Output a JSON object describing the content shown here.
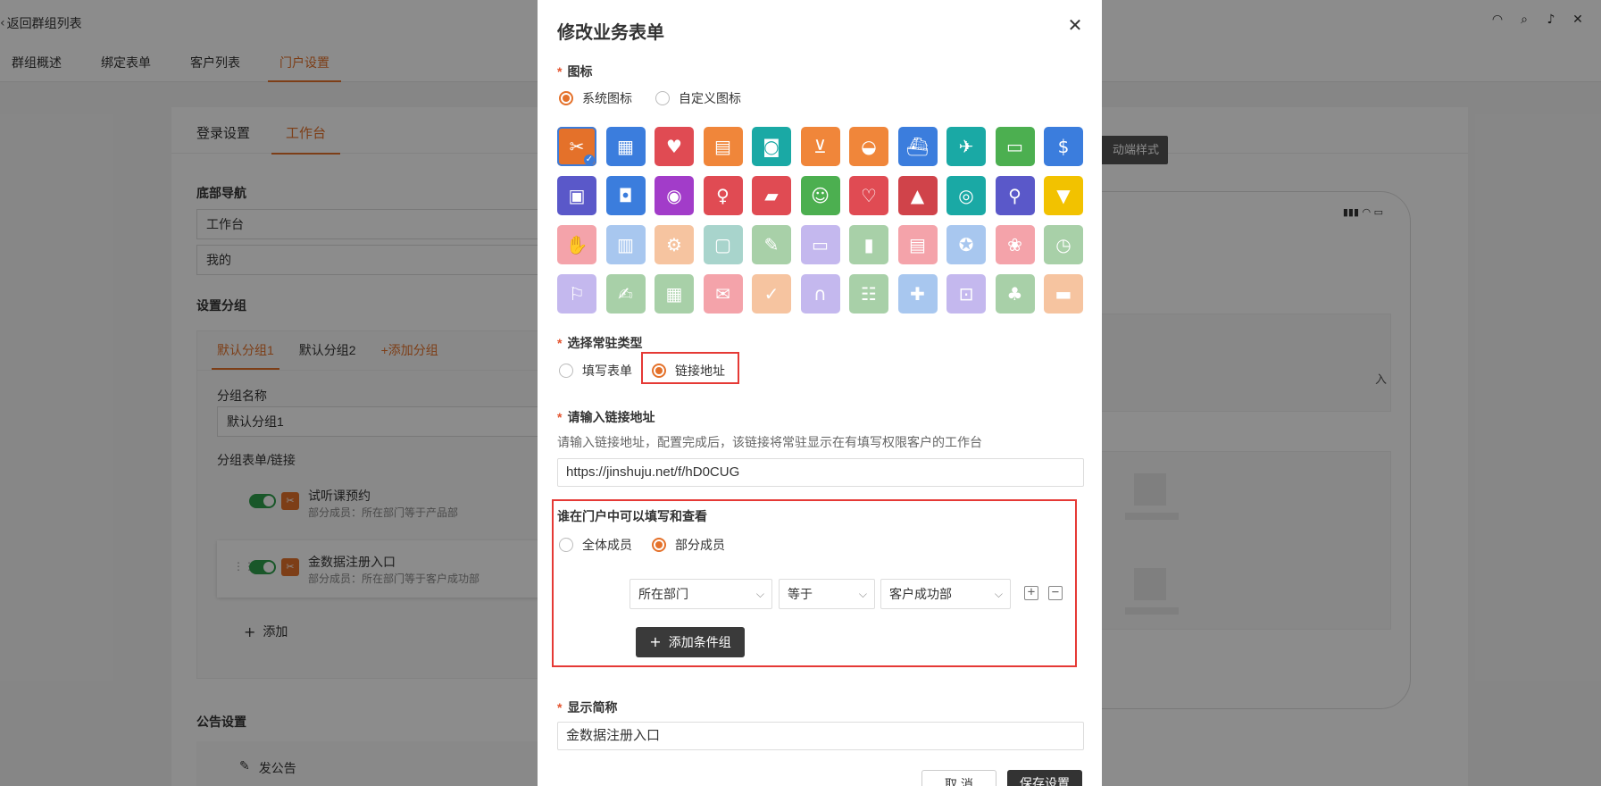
{
  "app": {
    "back_label": "返回群组列表",
    "top_tabs": [
      "群组概述",
      "绑定表单",
      "客户列表",
      "门户设置"
    ],
    "active_top_tab": 3,
    "sub_tabs": [
      "登录设置",
      "工作台"
    ],
    "bottom_nav_title": "底部导航",
    "bottom_nav_items": [
      "工作台",
      "我的"
    ],
    "group_settings_title": "设置分组",
    "group_tabs": [
      "默认分组1",
      "默认分组2",
      "+添加分组"
    ],
    "group_name_label": "分组名称",
    "group_name_value": "默认分组1",
    "group_links_label": "分组表单/链接",
    "links": [
      {
        "title": "试听课预约",
        "sub": "部分成员：所在部门等于产品部"
      },
      {
        "title": "金数据注册入口",
        "sub": "部分成员：所在部门等于客户成功部"
      }
    ],
    "add_label": "添加",
    "announcement_title": "公告设置",
    "post_announcement": "发公告",
    "dark_button": "动端样式",
    "phone_status": "▮▮▮ ◠ ▭",
    "phone_card_text": "入"
  },
  "modal": {
    "title": "修改业务表单",
    "icon_label": "图标",
    "icon_options": [
      "系统图标",
      "自定义图标"
    ],
    "icon_grid": [
      {
        "name": "fork-knife-icon",
        "glyph": "✂",
        "bg": "#e4712a"
      },
      {
        "name": "factory-icon",
        "glyph": "▦",
        "bg": "#3b7ddd"
      },
      {
        "name": "heart-icon",
        "glyph": "♥",
        "bg": "#e04b53"
      },
      {
        "name": "document-icon",
        "glyph": "▤",
        "bg": "#f0863a"
      },
      {
        "name": "drink-icon",
        "glyph": "◙",
        "bg": "#1aa9a5"
      },
      {
        "name": "cart-icon",
        "glyph": "⊻",
        "bg": "#f0863a"
      },
      {
        "name": "bowl-icon",
        "glyph": "◒",
        "bg": "#f0863a"
      },
      {
        "name": "ship-icon",
        "glyph": "⛴",
        "bg": "#3b7ddd"
      },
      {
        "name": "plane-icon",
        "glyph": "✈",
        "bg": "#1aa9a5"
      },
      {
        "name": "book-icon",
        "glyph": "▭",
        "bg": "#4caf50"
      },
      {
        "name": "dollar-icon",
        "glyph": "$",
        "bg": "#3b7ddd"
      },
      {
        "name": "bus-icon",
        "glyph": "▣",
        "bg": "#5a58c9"
      },
      {
        "name": "taxi-icon",
        "glyph": "◘",
        "bg": "#3b7ddd"
      },
      {
        "name": "camera-app-icon",
        "glyph": "◉",
        "bg": "#a23cc9"
      },
      {
        "name": "dress-icon",
        "glyph": "♀",
        "bg": "#e04b53"
      },
      {
        "name": "cake-icon",
        "glyph": "▰",
        "bg": "#e04b53"
      },
      {
        "name": "person-icon",
        "glyph": "☺",
        "bg": "#4caf50"
      },
      {
        "name": "heart-hand-icon",
        "glyph": "♡",
        "bg": "#e04b53"
      },
      {
        "name": "graduation-cap-icon",
        "glyph": "▲",
        "bg": "#d0434a"
      },
      {
        "name": "camera-icon",
        "glyph": "◎",
        "bg": "#1aa9a5"
      },
      {
        "name": "bicycle-icon",
        "glyph": "⚲",
        "bg": "#5a58c9"
      },
      {
        "name": "tshirt-icon",
        "glyph": "▼",
        "bg": "#f2c200"
      },
      {
        "name": "handshake-icon",
        "glyph": "✋",
        "bg": "#f4a3aa"
      },
      {
        "name": "chart-icon",
        "glyph": "▥",
        "bg": "#a8c7ef"
      },
      {
        "name": "tools-icon",
        "glyph": "⚙",
        "bg": "#f6c4a0"
      },
      {
        "name": "presentation-icon",
        "glyph": "▢",
        "bg": "#a8d4cc"
      },
      {
        "name": "stationery-icon",
        "glyph": "✎",
        "bg": "#a8d0a8"
      },
      {
        "name": "computer-icon",
        "glyph": "▭",
        "bg": "#c4b8ee"
      },
      {
        "name": "bottle-icon",
        "glyph": "▮",
        "bg": "#a8d0a8"
      },
      {
        "name": "gallery-icon",
        "glyph": "▤",
        "bg": "#f4a3aa"
      },
      {
        "name": "medal-icon",
        "glyph": "✪",
        "bg": "#a8c7ef"
      },
      {
        "name": "laurel-icon",
        "glyph": "❀",
        "bg": "#f4a3aa"
      },
      {
        "name": "cup-icon",
        "glyph": "◷",
        "bg": "#a8d0a8"
      },
      {
        "name": "location-icon",
        "glyph": "⚐",
        "bg": "#c4b8ee"
      },
      {
        "name": "register-icon",
        "glyph": "✍",
        "bg": "#a8d0a8"
      },
      {
        "name": "building-icon",
        "glyph": "▦",
        "bg": "#a8d0a8"
      },
      {
        "name": "gift-icon",
        "glyph": "✉",
        "bg": "#f4a3aa"
      },
      {
        "name": "message-icon",
        "glyph": "✓",
        "bg": "#f6c4a0"
      },
      {
        "name": "arch-icon",
        "glyph": "∩",
        "bg": "#c4b8ee"
      },
      {
        "name": "chat-icon",
        "glyph": "☷",
        "bg": "#a8d0a8"
      },
      {
        "name": "gamepad-icon",
        "glyph": "✚",
        "bg": "#a8c7ef"
      },
      {
        "name": "lock-icon",
        "glyph": "⊡",
        "bg": "#c4b8ee"
      },
      {
        "name": "tree-icon",
        "glyph": "♣",
        "bg": "#a8d0a8"
      },
      {
        "name": "toggle-icon",
        "glyph": "▬",
        "bg": "#f6c4a0"
      }
    ],
    "type_label": "选择常驻类型",
    "type_options": [
      "填写表单",
      "链接地址"
    ],
    "url_label": "请输入链接地址",
    "url_hint": "请输入链接地址，配置完成后，该链接将常驻显示在有填写权限客户的工作台",
    "url_value": "https://jinshuju.net/f/hD0CUG",
    "visibility_label": "谁在门户中可以填写和查看",
    "visibility_options": [
      "全体成员",
      "部分成员"
    ],
    "condition": {
      "field": "所在部门",
      "operator": "等于",
      "value": "客户成功部"
    },
    "add_condition_group": "添加条件组",
    "short_name_label": "显示简称",
    "short_name_value": "金数据注册入口",
    "cancel": "取 消",
    "save": "保存设置"
  },
  "colors": {
    "accent": "#e4712a",
    "highlight_box": "#e53935",
    "dark_button": "#333333"
  }
}
